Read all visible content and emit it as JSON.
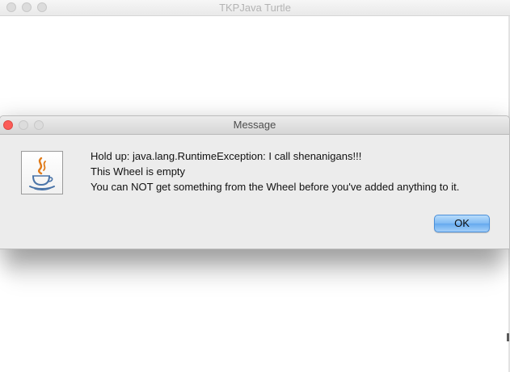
{
  "background_window": {
    "title": "TKPJava Turtle"
  },
  "dialog": {
    "title": "Message",
    "icon": "java-coffee-cup-icon",
    "lines": [
      "Hold up: java.lang.RuntimeException: I call shenanigans!!!",
      "This Wheel is empty",
      "You can NOT get something from the Wheel before you've added anything to it."
    ],
    "ok_label": "OK"
  },
  "colors": {
    "close_button": "#fc5b57",
    "ok_button": "#7fbaf3",
    "dialog_background": "#ececec"
  }
}
